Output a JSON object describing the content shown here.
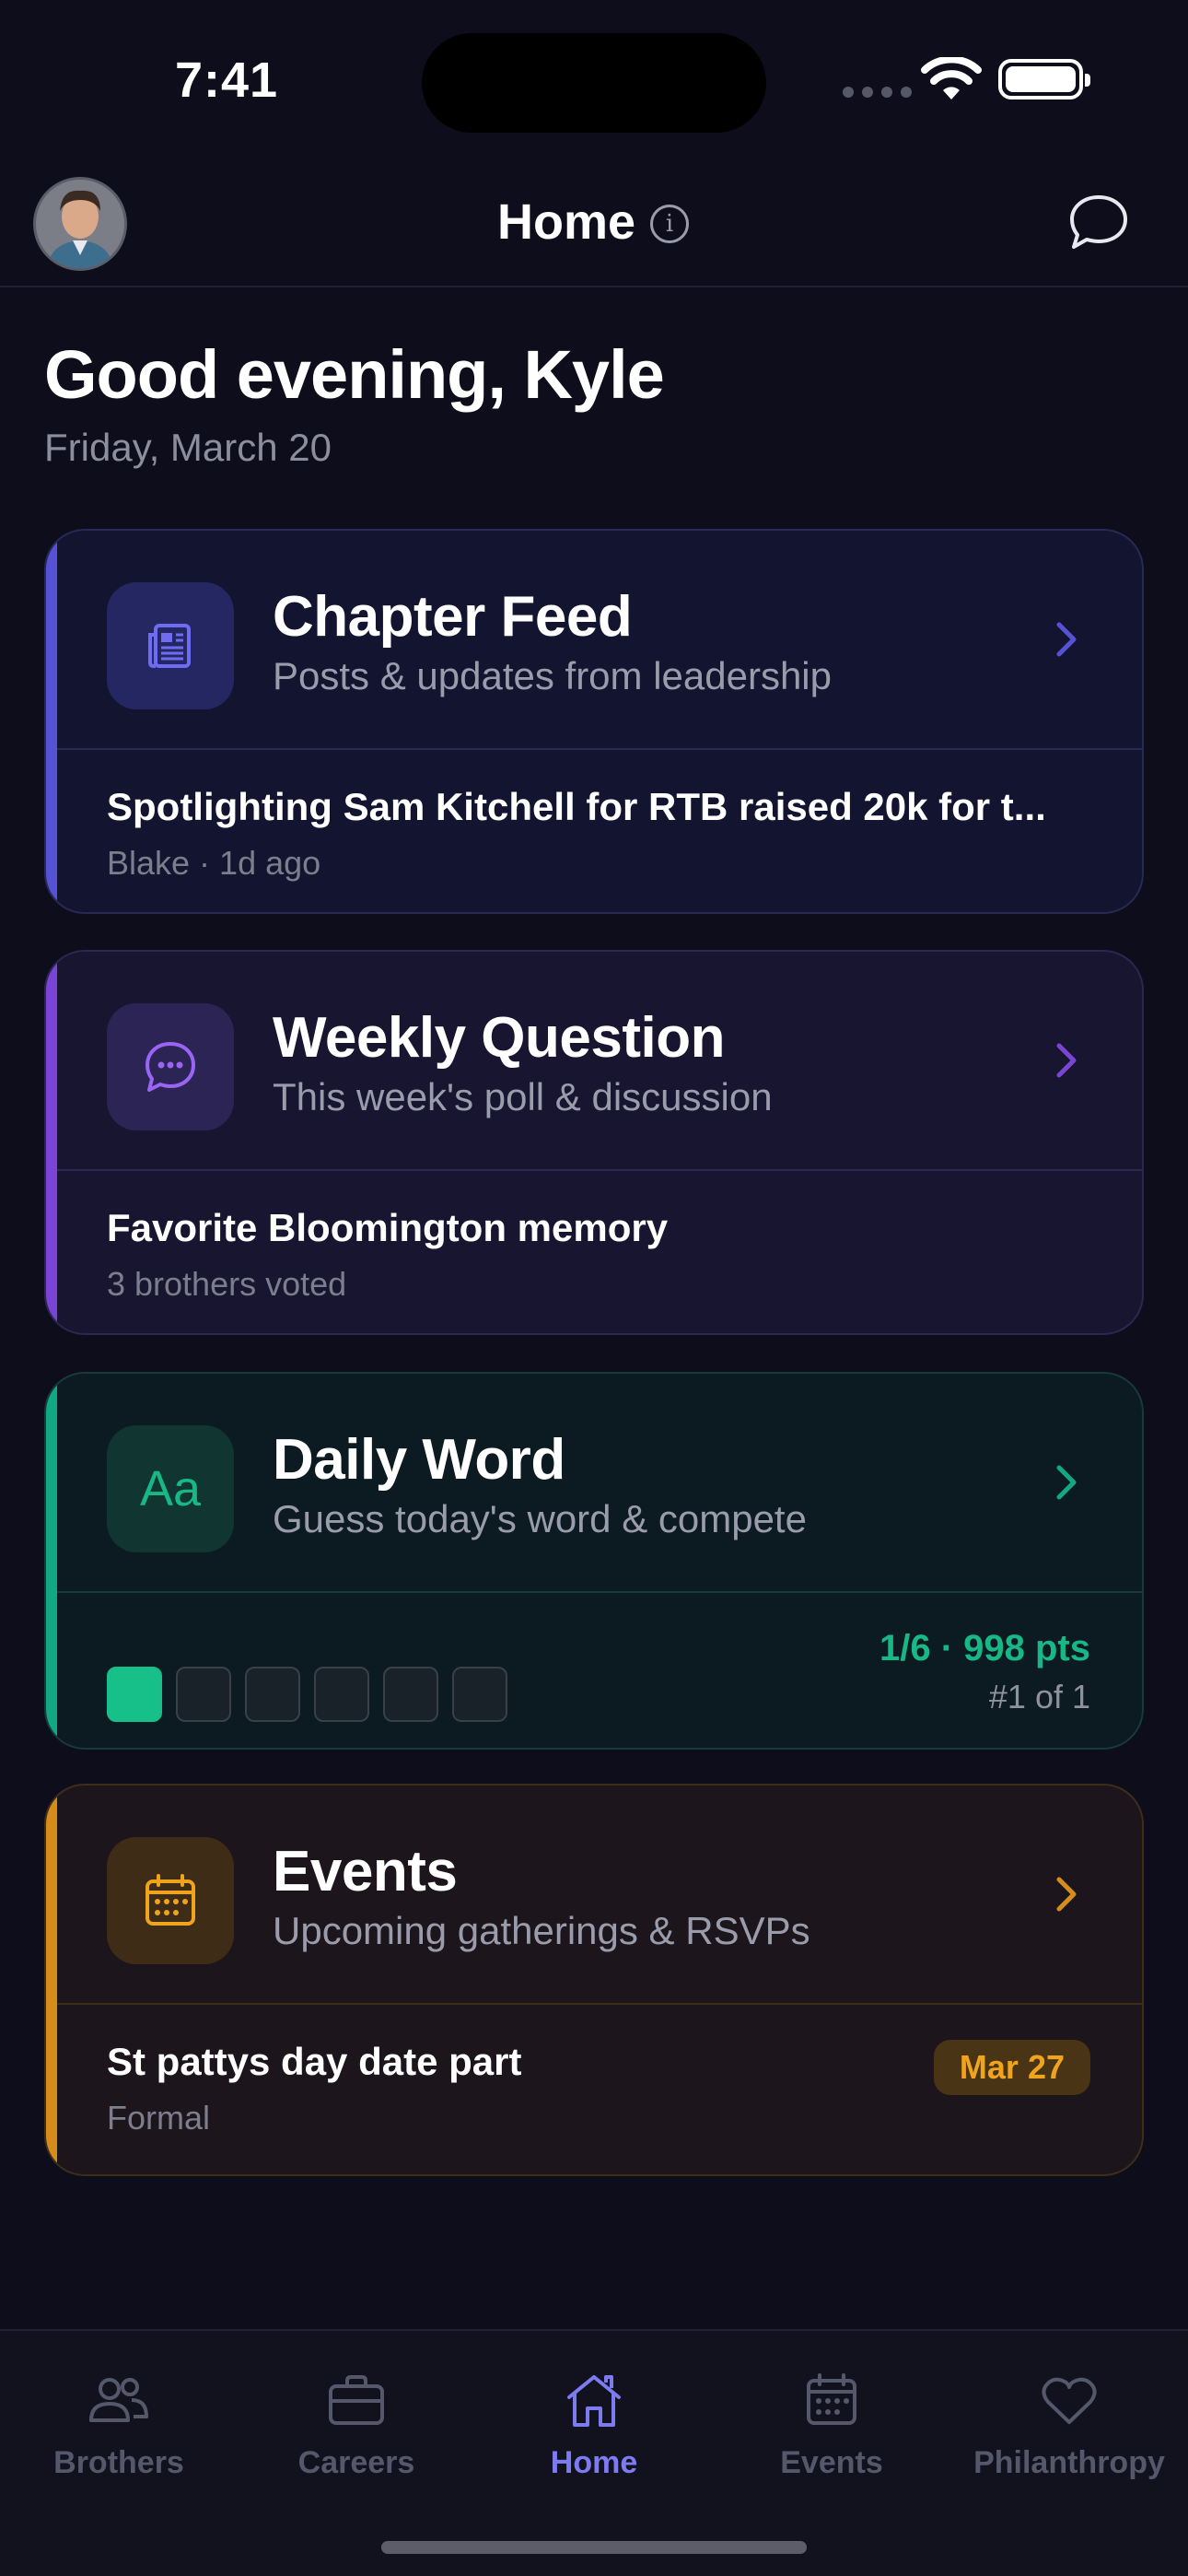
{
  "status": {
    "time": "7:41"
  },
  "header": {
    "title": "Home",
    "info_icon": "info-icon",
    "chat_icon": "chat-bubble-icon"
  },
  "greeting": {
    "text": "Good evening, Kyle",
    "date": "Friday, March 20"
  },
  "cards": [
    {
      "title": "Chapter Feed",
      "subtitle": "Posts & updates from leadership",
      "icon": "newspaper-icon",
      "accent": "#5552d6",
      "post_title": "Spotlighting Sam Kitchell for RTB raised 20k for t...",
      "post_meta": "Blake · 1d ago"
    },
    {
      "title": "Weekly Question",
      "subtitle": "This week's poll & discussion",
      "icon": "chat-dots-icon",
      "accent": "#7a45d6",
      "post_title": "Favorite Bloomington memory",
      "post_meta": "3 brothers voted"
    },
    {
      "title": "Daily Word",
      "subtitle": "Guess today's word & compete",
      "icon": "text-aa-icon",
      "icon_text": "Aa",
      "accent": "#12a884",
      "score": "1/6 · 998 pts",
      "rank": "#1 of 1",
      "tiles_filled": 1,
      "tiles_total": 6
    },
    {
      "title": "Events",
      "subtitle": "Upcoming gatherings & RSVPs",
      "icon": "calendar-icon",
      "accent": "#d68c1a",
      "post_title": "St pattys day date part",
      "post_meta": "Formal",
      "badge": "Mar 27"
    }
  ],
  "tabs": [
    {
      "label": "Brothers",
      "icon": "people-icon",
      "active": false
    },
    {
      "label": "Careers",
      "icon": "briefcase-icon",
      "active": false
    },
    {
      "label": "Home",
      "icon": "home-icon",
      "active": true
    },
    {
      "label": "Events",
      "icon": "calendar-icon",
      "active": false
    },
    {
      "label": "Philanthropy",
      "icon": "heart-icon",
      "active": false
    }
  ],
  "colors": {
    "background": "#0d0d1c",
    "active_tab": "#7c7cf0",
    "inactive_tab": "#55586a"
  }
}
